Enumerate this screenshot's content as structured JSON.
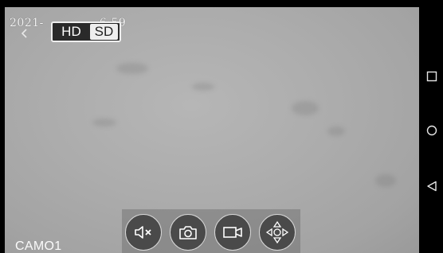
{
  "overlay": {
    "timestamp_visible_start": "2021-",
    "timestamp_visible_end": "6:59",
    "camera_label": "CAMO1"
  },
  "quality_toggle": {
    "options": [
      "HD",
      "SD"
    ],
    "selected": "SD"
  },
  "controls": [
    {
      "name": "mute-button",
      "icon": "speaker-muted-icon"
    },
    {
      "name": "snapshot-button",
      "icon": "camera-icon"
    },
    {
      "name": "record-button",
      "icon": "video-camera-icon"
    },
    {
      "name": "ptz-button",
      "icon": "directional-pad-icon"
    }
  ],
  "system_nav": [
    {
      "name": "recent-apps-button",
      "icon": "square-icon"
    },
    {
      "name": "home-button",
      "icon": "circle-icon"
    },
    {
      "name": "back-nav-button",
      "icon": "triangle-back-icon"
    }
  ],
  "colors": {
    "feed_gray": "#acacac",
    "button_fill": "#4a4a4a",
    "toggle_selected_bg": "#eeeeee"
  }
}
